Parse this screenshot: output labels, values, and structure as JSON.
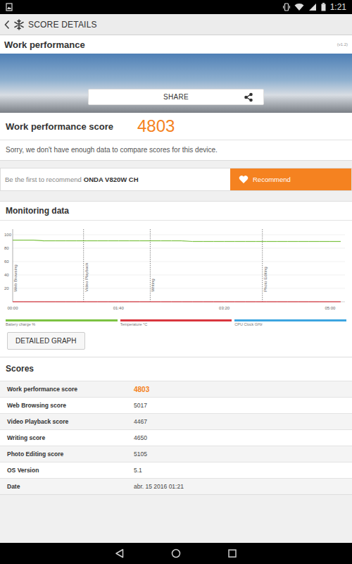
{
  "status_bar": {
    "time": "1:21"
  },
  "app_bar": {
    "title": "SCORE DETAILS"
  },
  "card": {
    "title": "Work performance",
    "version": "(v1.2)",
    "share": "SHARE",
    "score_label": "Work performance score",
    "score": "4803",
    "note": "Sorry, we don't have enough data to compare scores for this device."
  },
  "recommend": {
    "prompt": "Be the first to recommend",
    "device": "ONDA V820W CH",
    "button": "Recommend"
  },
  "monitoring": {
    "title": "Monitoring data",
    "y_ticks": [
      "100",
      "80",
      "60",
      "40",
      "20"
    ],
    "x_ticks": [
      "00:00",
      "01:40",
      "03:20",
      "05:00"
    ],
    "sections": [
      {
        "label": "Web Browsing",
        "start": 0
      },
      {
        "label": "Video Playback",
        "start": 67
      },
      {
        "label": "Writing",
        "start": 130
      },
      {
        "label": "Photo Editing",
        "start": 236
      }
    ],
    "series": [
      {
        "label": "Battery charge %",
        "color": "#7cc242",
        "values": [
          92,
          92,
          92,
          91,
          91,
          91,
          91,
          91,
          91,
          91,
          91,
          91,
          91,
          91,
          91,
          91,
          91,
          90,
          90,
          90,
          90,
          90,
          90,
          90,
          90,
          90,
          90,
          90,
          90,
          90,
          90,
          90
        ]
      },
      {
        "label": "Temperature °C",
        "color": "#d9363e",
        "values": [
          0,
          0,
          0,
          0,
          0,
          0,
          0,
          0,
          0,
          0,
          0,
          0,
          0,
          0,
          0,
          0,
          0,
          0,
          0,
          0,
          0,
          0,
          0,
          0,
          0,
          0,
          0,
          0,
          0,
          0,
          0,
          0
        ]
      },
      {
        "label": "CPU Clock GHz",
        "color": "#3da5e0",
        "values": []
      }
    ],
    "button": "DETAILED GRAPH"
  },
  "scores": {
    "title": "Scores",
    "rows": [
      {
        "label": "Work performance score",
        "value": "4803",
        "highlight": true
      },
      {
        "label": "Web Browsing score",
        "value": "5017",
        "highlight": false
      },
      {
        "label": "Video Playback score",
        "value": "4467",
        "highlight": false
      },
      {
        "label": "Writing score",
        "value": "4650",
        "highlight": false
      },
      {
        "label": "Photo Editing score",
        "value": "5105",
        "highlight": false
      },
      {
        "label": "OS Version",
        "value": "5.1",
        "highlight": false
      },
      {
        "label": "Date",
        "value": "abr. 15 2016 01:21",
        "highlight": false
      }
    ]
  }
}
